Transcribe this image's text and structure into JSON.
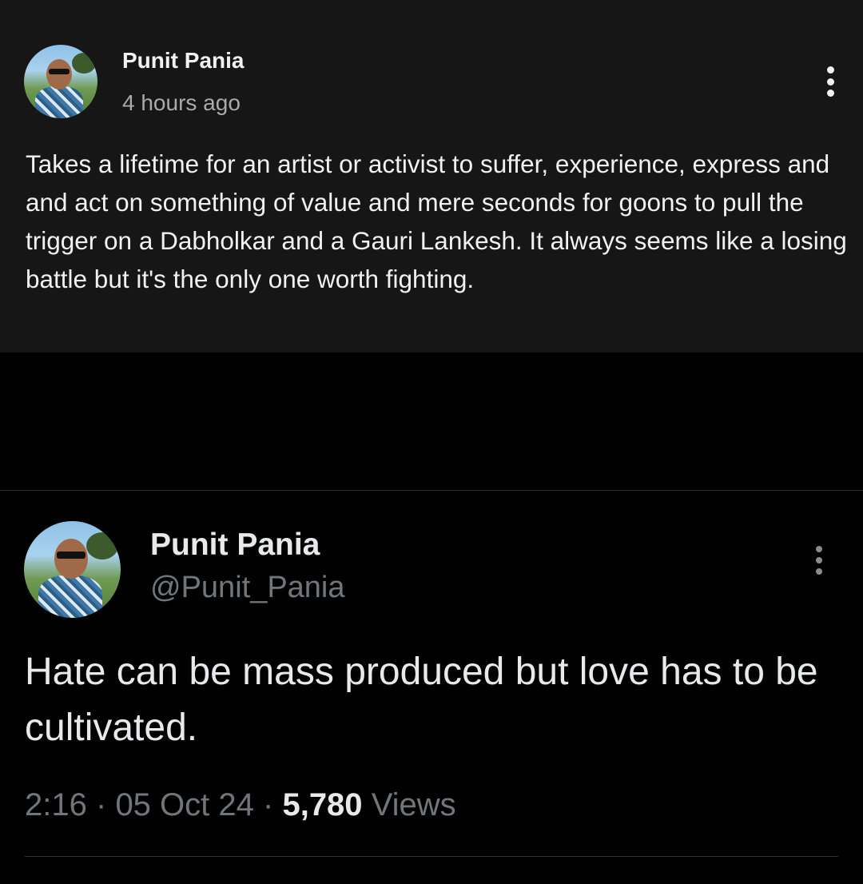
{
  "comment_post": {
    "author": "Punit Pania",
    "time": "4 hours ago",
    "text": "Takes a lifetime for an artist or activist to suffer, experience, express and and act on something of value and mere seconds for goons to pull the trigger on a Dabholkar and a Gauri Lankesh. It always seems like a losing battle but it's the only one worth fighting.",
    "menu_icon": "more-vertical-icon"
  },
  "tweet": {
    "author": "Punit Pania",
    "handle": "@Punit_Pania",
    "text": "Hate can be mass produced but love has to be cultivated.",
    "time": "2:16",
    "date": "05 Oct 24",
    "views_count": "5,780",
    "views_label": "Views",
    "separator": "·",
    "menu_icon": "more-vertical-icon"
  },
  "colors": {
    "background": "#000000",
    "comment_panel": "#161616",
    "primary_text": "#f1f1f1",
    "secondary_text": "#aaaaaa",
    "tweet_text": "#e7e9ea",
    "tweet_muted": "#71767b"
  }
}
